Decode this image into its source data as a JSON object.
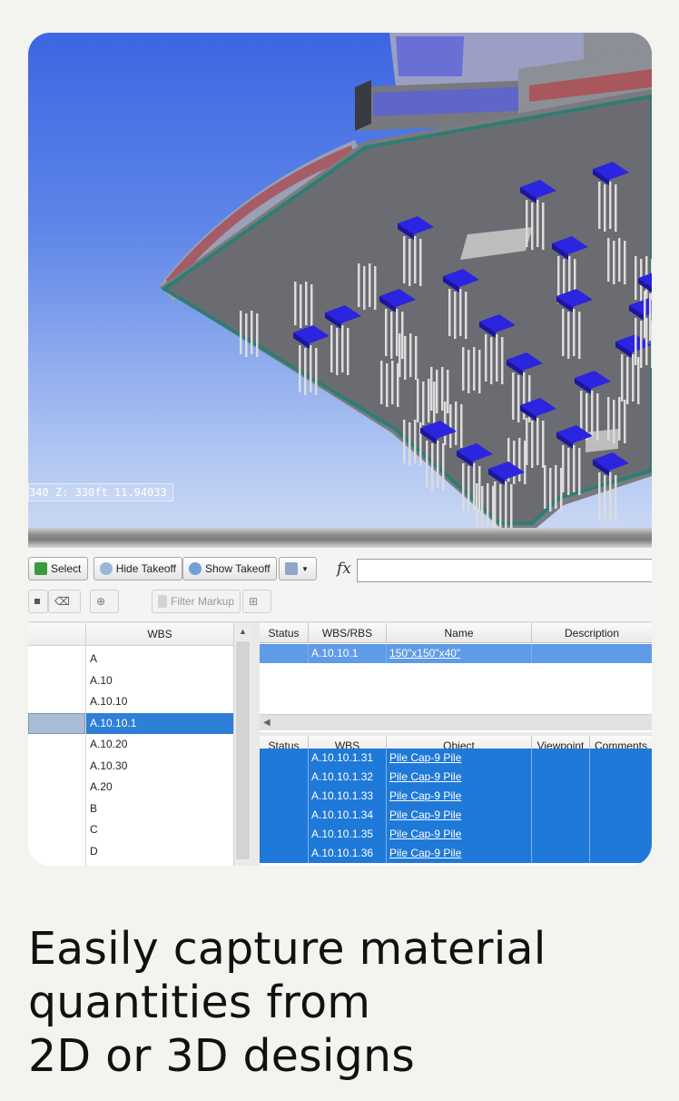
{
  "viewport": {
    "coordinate_readout": "340  Z: 330ft 11.94033"
  },
  "toolbar": {
    "select_label": "Select",
    "hide_takeoff_label": "Hide Takeoff",
    "show_takeoff_label": "Show Takeoff",
    "formula_symbol": "fx",
    "filter_markup_label": "Filter Markup"
  },
  "wbs_tree": {
    "header": "WBS",
    "items": [
      {
        "label": "A",
        "selected": false
      },
      {
        "label": "A.10",
        "selected": false
      },
      {
        "label": "A.10.10",
        "selected": false
      },
      {
        "label": "A.10.10.1",
        "selected": true
      },
      {
        "label": "A.10.20",
        "selected": false
      },
      {
        "label": "A.10.30",
        "selected": false
      },
      {
        "label": "A.20",
        "selected": false
      },
      {
        "label": "B",
        "selected": false
      },
      {
        "label": "C",
        "selected": false
      },
      {
        "label": "D",
        "selected": false
      }
    ]
  },
  "takeoff_grid": {
    "headers": [
      "Status",
      "WBS/RBS",
      "Name",
      "Description"
    ],
    "rows": [
      {
        "status": "",
        "wbs": "A.10.10.1",
        "name": "150\"x150\"x40\"",
        "description": ""
      }
    ]
  },
  "objects_grid": {
    "headers": [
      "Status",
      "WBS",
      "Object",
      "Viewpoint",
      "Comments"
    ],
    "rows": [
      {
        "status": "",
        "wbs": "A.10.10.1.31",
        "object": "Pile Cap-9 Pile"
      },
      {
        "status": "",
        "wbs": "A.10.10.1.32",
        "object": "Pile Cap-9 Pile"
      },
      {
        "status": "",
        "wbs": "A.10.10.1.33",
        "object": "Pile Cap-9 Pile"
      },
      {
        "status": "",
        "wbs": "A.10.10.1.34",
        "object": "Pile Cap-9 Pile"
      },
      {
        "status": "",
        "wbs": "A.10.10.1.35",
        "object": "Pile Cap-9 Pile"
      },
      {
        "status": "",
        "wbs": "A.10.10.1.36",
        "object": "Pile Cap-9 Pile"
      }
    ]
  },
  "headline": {
    "line1": "Easily capture material",
    "line2": "quantities from",
    "line3": "2D or 3D designs"
  },
  "colors": {
    "selection_blue": "#1f79d8",
    "pile_cap_blue": "#2b24e0",
    "sky_top": "#3c66e2"
  }
}
